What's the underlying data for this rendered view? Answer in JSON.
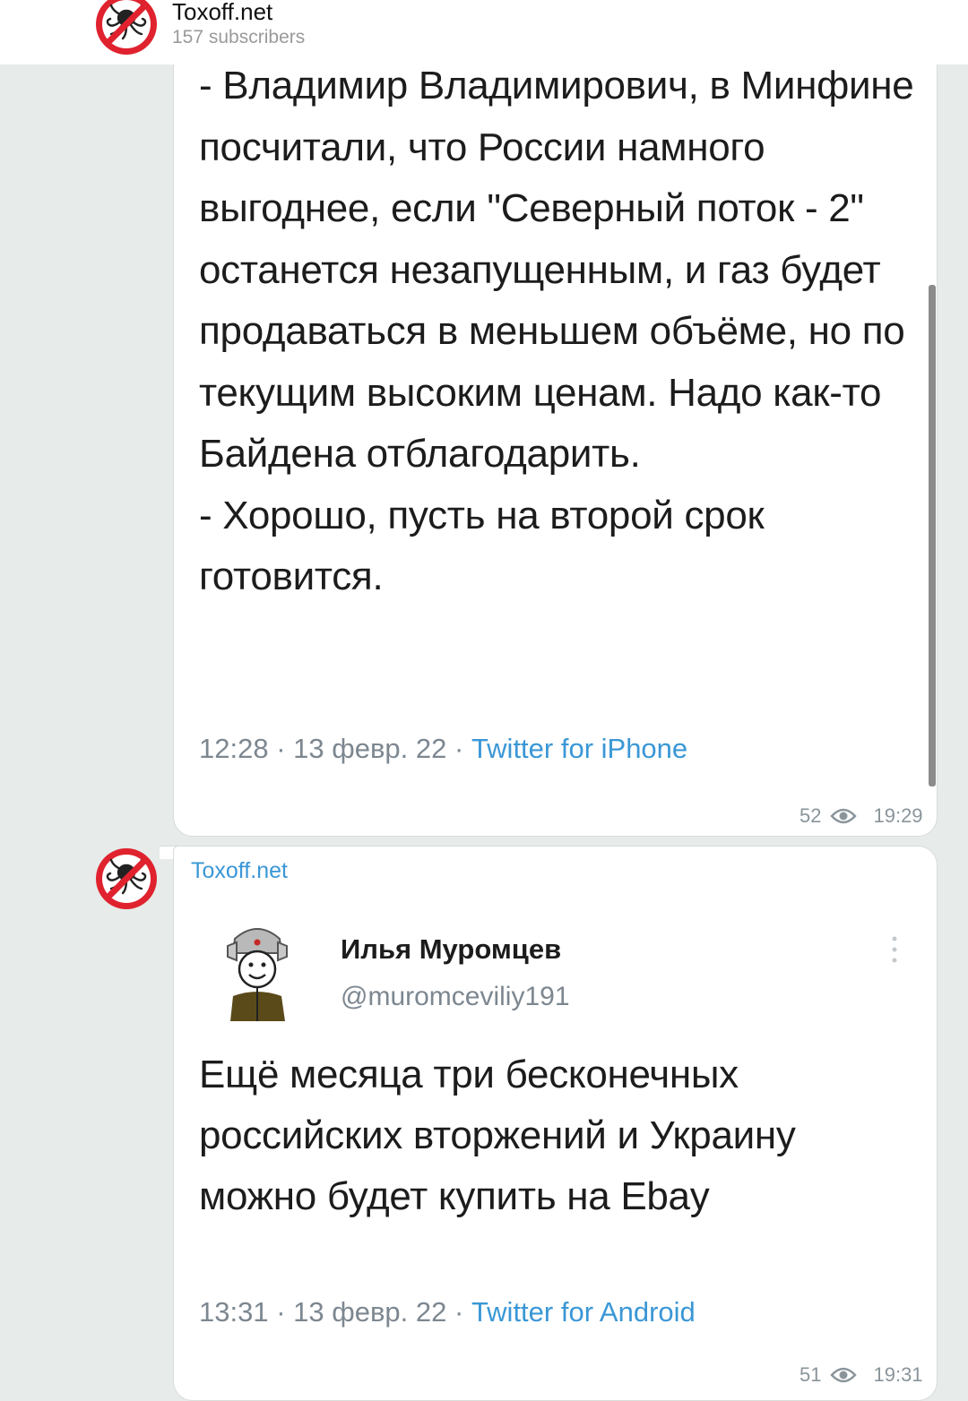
{
  "header": {
    "title": "Toxoff.net",
    "subscribers": "157 subscribers"
  },
  "message1": {
    "text": "- Владимир Владимирович, в Минфине посчитали, что России намного выгоднее, если \"Северный поток - 2\" останется незапущенным, и газ будет продаваться в меньшем объёме, но по текущим высоким ценам. Надо как-то Байдена отблагодарить.\n- Хорошо, пусть на второй срок готовится.",
    "tweet_time": "12:28 · 13 февр. 22 · ",
    "tweet_source": "Twitter for iPhone",
    "views": "52",
    "time": "19:29"
  },
  "message2": {
    "sender": "Toxoff.net",
    "author_name": "Илья Муромцев",
    "author_handle": "@muromceviliy191",
    "text": "Ещё месяца три бесконечных российских вторжений и Украину можно будет купить на Ebay",
    "tweet_time": "13:31 · 13 февр. 22 · ",
    "tweet_source": "Twitter for Android",
    "views": "51",
    "time": "19:31"
  },
  "icons": {
    "channel_avatar": "octopus-logo-icon",
    "views": "eye-icon",
    "more": "more-vertical-icon"
  },
  "colors": {
    "accent": "#3a97d6",
    "logo_red": "#e0222f"
  }
}
